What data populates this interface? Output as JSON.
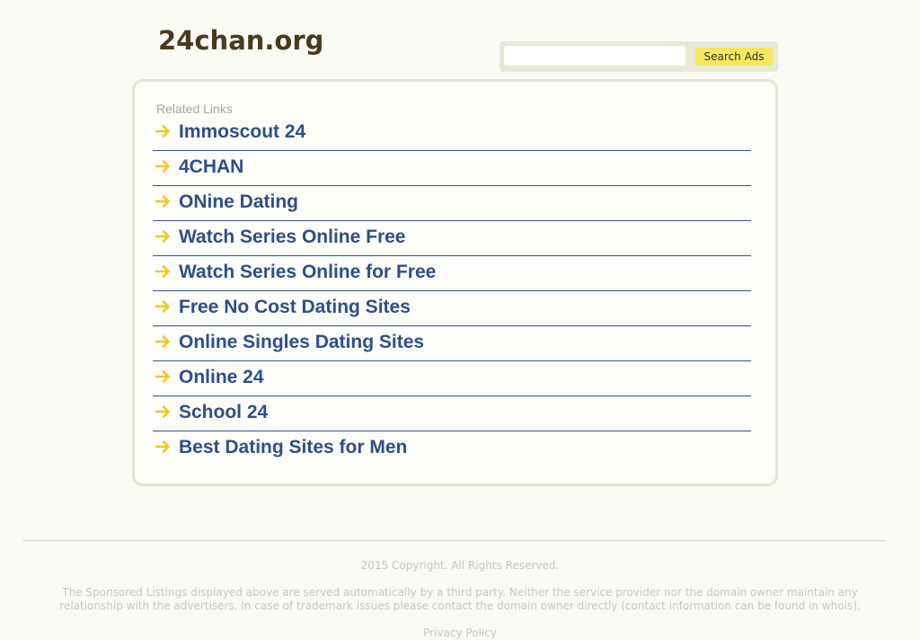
{
  "header": {
    "site_title": "24chan.org"
  },
  "search": {
    "placeholder": "",
    "value": "",
    "button_label": "Search Ads"
  },
  "panel": {
    "heading": "Related Links",
    "links": [
      {
        "label": "Immoscout 24"
      },
      {
        "label": "4CHAN"
      },
      {
        "label": "ONine Dating"
      },
      {
        "label": "Watch Series Online Free"
      },
      {
        "label": "Watch Series Online for Free"
      },
      {
        "label": "Free No Cost Dating Sites"
      },
      {
        "label": "Online Singles Dating Sites"
      },
      {
        "label": "Online 24"
      },
      {
        "label": "School 24"
      },
      {
        "label": "Best Dating Sites for Men"
      }
    ]
  },
  "footer": {
    "copyright": "2015 Copyright. All Rights Reserved.",
    "disclaimer": "The Sponsored Listings displayed above are served automatically by a third party. Neither the service provider nor the domain owner maintain any relationship with the advertisers. In case of trademark issues please contact the domain owner directly (contact information can be found in whois).",
    "privacy_label": "Privacy Policy"
  },
  "colors": {
    "link": "#2d4f8a",
    "arrow": "#f2c81f",
    "button": "#f6e85b",
    "title": "#4a3a1c"
  },
  "icons": {
    "link_arrow": "arrow-right-icon"
  }
}
